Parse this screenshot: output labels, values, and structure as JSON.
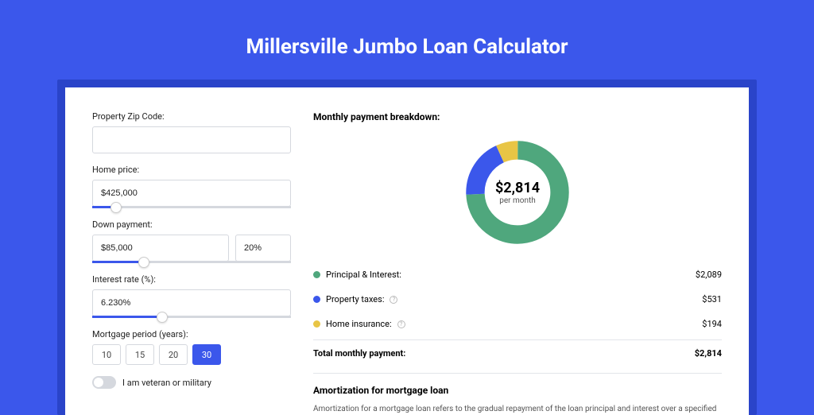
{
  "title": "Millersville Jumbo Loan Calculator",
  "form": {
    "zip_label": "Property Zip Code:",
    "zip_value": "",
    "price_label": "Home price:",
    "price_value": "$425,000",
    "price_slider": 12,
    "down_label": "Down payment:",
    "down_value": "$85,000",
    "down_pct_value": "20%",
    "down_slider": 26,
    "rate_label": "Interest rate (%):",
    "rate_value": "6.230%",
    "rate_slider": 35,
    "period_label": "Mortgage period (years):",
    "periods": [
      "10",
      "15",
      "20",
      "30"
    ],
    "period_selected": "30",
    "veteran_label": "I am veteran or military"
  },
  "breakdown": {
    "title": "Monthly payment breakdown:",
    "center_value": "$2,814",
    "center_sub": "per month",
    "items": [
      {
        "label": "Principal & Interest:",
        "value": "$2,089",
        "info": false
      },
      {
        "label": "Property taxes:",
        "value": "$531",
        "info": true
      },
      {
        "label": "Home insurance:",
        "value": "$194",
        "info": true
      }
    ],
    "total_label": "Total monthly payment:",
    "total_value": "$2,814"
  },
  "amort": {
    "title": "Amortization for mortgage loan",
    "text": "Amortization for a mortgage loan refers to the gradual repayment of the loan principal and interest over a specified"
  },
  "chart_data": {
    "type": "pie",
    "title": "Monthly payment breakdown",
    "series": [
      {
        "name": "Principal & Interest",
        "value": 2089,
        "color": "#4fa77d"
      },
      {
        "name": "Property taxes",
        "value": 531,
        "color": "#3b57eb"
      },
      {
        "name": "Home insurance",
        "value": 194,
        "color": "#e8c545"
      }
    ],
    "total": 2814
  }
}
